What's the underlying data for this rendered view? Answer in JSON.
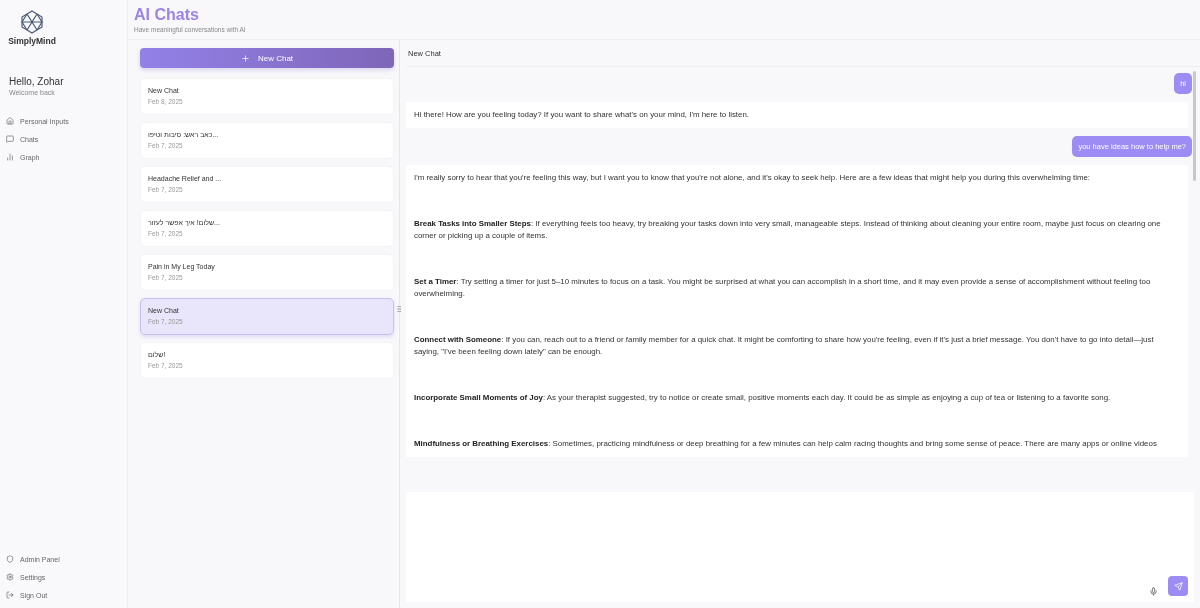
{
  "sidebar": {
    "logo": "SimplyMind",
    "greeting": "Hello, Zohar",
    "subtitle": "Welcome back",
    "nav": [
      {
        "label": "Personal Inputs",
        "kind": "home"
      },
      {
        "label": "Chats",
        "kind": "chat"
      },
      {
        "label": "Graph",
        "kind": "graph"
      }
    ],
    "footer": [
      {
        "label": "Admin Panel",
        "kind": "shield"
      },
      {
        "label": "Settings",
        "kind": "gear"
      },
      {
        "label": "Sign Out",
        "kind": "signout"
      }
    ]
  },
  "header": {
    "title": "AI Chats",
    "subtitle": "Have meaningful conversations with AI"
  },
  "chat_list": {
    "new_button": "New Chat",
    "items": [
      {
        "title": "New Chat",
        "date": "Feb 8, 2025",
        "selected": false
      },
      {
        "title": "כאב ראש: סיבות וטיפו...",
        "date": "Feb 7, 2025",
        "selected": false
      },
      {
        "title": "Headache Relief and ...",
        "date": "Feb 7, 2025",
        "selected": false
      },
      {
        "title": "שלום! איך אפשר לעזור...",
        "date": "Feb 7, 2025",
        "selected": false
      },
      {
        "title": "Pain in My Leg Today",
        "date": "Feb 7, 2025",
        "selected": false
      },
      {
        "title": "New Chat",
        "date": "Feb 7, 2025",
        "selected": true
      },
      {
        "title": "שלום!",
        "date": "Feb 7, 2025",
        "selected": false
      }
    ]
  },
  "chat": {
    "title": "New Chat",
    "messages": [
      {
        "kind": "user",
        "paragraphs": [
          "hi"
        ]
      },
      {
        "kind": "assistant",
        "paragraphs": [
          "Hi there! How are you feeling today? If you want to share what's on your mind, I'm here to listen."
        ]
      },
      {
        "kind": "user",
        "paragraphs": [
          "you have ideas how to help me?"
        ]
      },
      {
        "kind": "assistant",
        "paragraphs": [
          "I'm really sorry to hear that you're feeling this way, but I want you to know that you're not alone, and it's okay to seek help. Here are a few ideas that might help you during this overwhelming time:",
          "**Break Tasks into Smaller Steps**: If everything feels too heavy, try breaking your tasks down into very small, manageable steps. Instead of thinking about cleaning your entire room, maybe just focus on clearing one corner or picking up a couple of items.",
          "**Set a Timer**: Try setting a timer for just 5–10 minutes to focus on a task. You might be surprised at what you can accomplish in a short time, and it may even provide a sense of accomplishment without feeling too overwhelming.",
          "**Connect with Someone**: If you can, reach out to a friend or family member for a quick chat. It might be comforting to share how you're feeling, even if it's just a brief message. You don't have to go into detail—just saying, \"I've been feeling down lately\" can be enough.",
          "**Incorporate Small Moments of Joy**: As your therapist suggested, try to notice or create small, positive moments each day. It could be as simple as enjoying a cup of tea or listening to a favorite song.",
          "**Mindfulness or Breathing Exercises**: Sometimes, practicing mindfulness or deep breathing for a few minutes can help calm racing thoughts and bring some sense of peace. There are many apps or online videos"
        ]
      }
    ]
  }
}
